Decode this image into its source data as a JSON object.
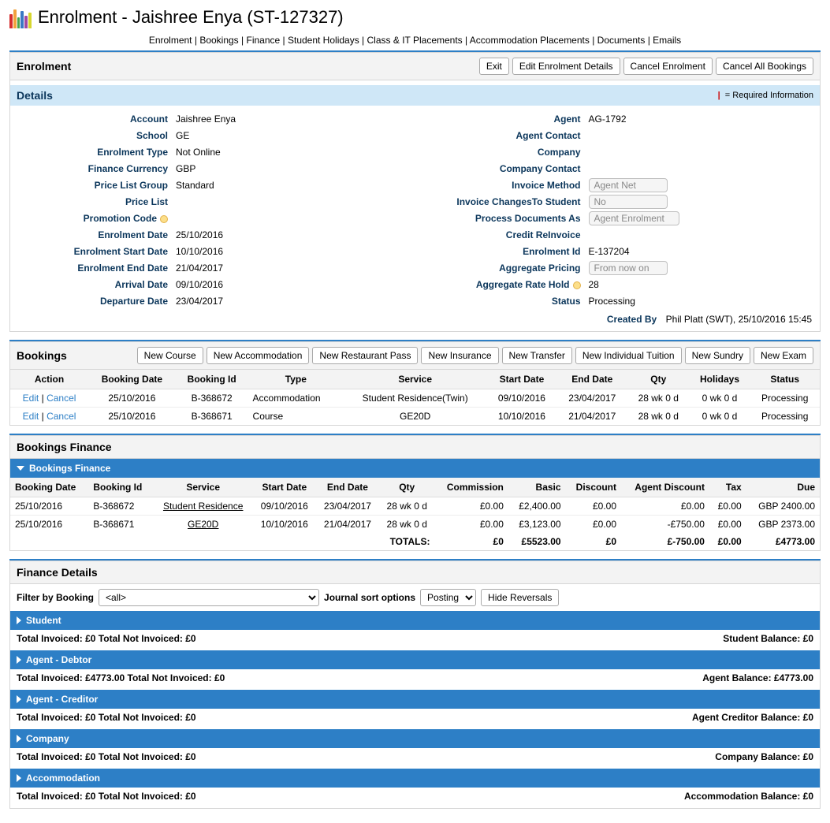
{
  "page_title": "Enrolment - Jaishree Enya (ST-127327)",
  "top_nav": [
    "Enrolment",
    "Bookings",
    "Finance",
    "Student Holidays",
    "Class & IT Placements",
    "Accommodation Placements",
    "Documents",
    "Emails"
  ],
  "enrolment_panel": {
    "title": "Enrolment",
    "buttons": [
      "Exit",
      "Edit Enrolment Details",
      "Cancel Enrolment",
      "Cancel All Bookings"
    ]
  },
  "details_bar": {
    "title": "Details",
    "required_note": "= Required Information"
  },
  "details": {
    "left": [
      {
        "label": "Account",
        "value": "Jaishree Enya"
      },
      {
        "label": "School",
        "value": "GE"
      },
      {
        "label": "Enrolment Type",
        "value": "Not Online"
      },
      {
        "label": "Finance Currency",
        "value": "GBP"
      },
      {
        "label": "Price List Group",
        "value": "Standard"
      },
      {
        "label": "Price List",
        "value": ""
      },
      {
        "label": "Promotion Code",
        "value": "",
        "dot": true
      },
      {
        "label": "Enrolment Date",
        "value": "25/10/2016"
      },
      {
        "label": "Enrolment Start Date",
        "value": "10/10/2016"
      },
      {
        "label": "Enrolment End Date",
        "value": "21/04/2017"
      },
      {
        "label": "Arrival Date",
        "value": "09/10/2016"
      },
      {
        "label": "Departure Date",
        "value": "23/04/2017"
      }
    ],
    "right": [
      {
        "label": "Agent",
        "value": "AG-1792"
      },
      {
        "label": "Agent Contact",
        "value": ""
      },
      {
        "label": "Company",
        "value": ""
      },
      {
        "label": "Company Contact",
        "value": ""
      },
      {
        "label": "Invoice Method",
        "select": "Agent Net"
      },
      {
        "label": "Invoice ChangesTo Student",
        "select": "No"
      },
      {
        "label": "Process Documents As",
        "select": "Agent Enrolment"
      },
      {
        "label": "Credit ReInvoice",
        "value": ""
      },
      {
        "label": "Enrolment Id",
        "value": "E-137204"
      },
      {
        "label": "Aggregate Pricing",
        "select": "From now on"
      },
      {
        "label": "Aggregate Rate Hold",
        "value": "28",
        "dot": true
      },
      {
        "label": "Status",
        "value": "Processing"
      }
    ],
    "created_by_label": "Created By",
    "created_by_value": "Phil Platt (SWT), 25/10/2016 15:45"
  },
  "bookings_panel": {
    "title": "Bookings",
    "buttons": [
      "New Course",
      "New Accommodation",
      "New Restaurant Pass",
      "New Insurance",
      "New Transfer",
      "New Individual Tuition",
      "New Sundry",
      "New Exam"
    ],
    "columns": [
      "Action",
      "Booking Date",
      "Booking Id",
      "Type",
      "Service",
      "Start Date",
      "End Date",
      "Qty",
      "Holidays",
      "Status"
    ],
    "rows": [
      {
        "action_edit": "Edit",
        "action_cancel": "Cancel",
        "date": "25/10/2016",
        "id": "B-368672",
        "type": "Accommodation",
        "service": "Student Residence(Twin)",
        "start": "09/10/2016",
        "end": "23/04/2017",
        "qty": "28 wk 0 d",
        "hol": "0 wk 0 d",
        "status": "Processing"
      },
      {
        "action_edit": "Edit",
        "action_cancel": "Cancel",
        "date": "25/10/2016",
        "id": "B-368671",
        "type": "Course",
        "service": "GE20D",
        "start": "10/10/2016",
        "end": "21/04/2017",
        "qty": "28 wk 0 d",
        "hol": "0 wk 0 d",
        "status": "Processing"
      }
    ]
  },
  "bookings_finance": {
    "panel_title": "Bookings Finance",
    "bar_title": "Bookings Finance",
    "columns": [
      "Booking Date",
      "Booking Id",
      "Service",
      "Start Date",
      "End Date",
      "Qty",
      "Commission",
      "Basic",
      "Discount",
      "Agent Discount",
      "Tax",
      "Due"
    ],
    "rows": [
      {
        "date": "25/10/2016",
        "id": "B-368672",
        "service": "Student Residence",
        "start": "09/10/2016",
        "end": "23/04/2017",
        "qty": "28 wk 0 d",
        "comm": "£0.00",
        "basic": "£2,400.00",
        "disc": "£0.00",
        "agent_disc": "£0.00",
        "tax": "£0.00",
        "due": "GBP 2400.00"
      },
      {
        "date": "25/10/2016",
        "id": "B-368671",
        "service": "GE20D",
        "start": "10/10/2016",
        "end": "21/04/2017",
        "qty": "28 wk 0 d",
        "comm": "£0.00",
        "basic": "£3,123.00",
        "disc": "£0.00",
        "agent_disc": "-£750.00",
        "tax": "£0.00",
        "due": "GBP 2373.00"
      }
    ],
    "totals": {
      "label": "TOTALS:",
      "comm": "£0",
      "basic": "£5523.00",
      "disc": "£0",
      "agent_disc": "£-750.00",
      "tax": "£0.00",
      "due": "£4773.00"
    }
  },
  "finance_details": {
    "title": "Finance Details",
    "filter_label": "Filter by Booking",
    "filter_value": "<all>",
    "journal_label": "Journal sort options",
    "journal_value": "Posting",
    "hide_button": "Hide Reversals",
    "sections": [
      {
        "name": "Student",
        "inv": "Total Invoiced: £0",
        "notinv": "Total Not Invoiced: £0",
        "bal": "Student Balance: £0"
      },
      {
        "name": "Agent - Debtor",
        "inv": "Total Invoiced: £4773.00",
        "notinv": "Total Not Invoiced: £0",
        "bal": "Agent Balance: £4773.00"
      },
      {
        "name": "Agent - Creditor",
        "inv": "Total Invoiced: £0",
        "notinv": "Total Not Invoiced: £0",
        "bal": "Agent Creditor Balance: £0"
      },
      {
        "name": "Company",
        "inv": "Total Invoiced: £0",
        "notinv": "Total Not Invoiced: £0",
        "bal": "Company Balance: £0"
      },
      {
        "name": "Accommodation",
        "inv": "Total Invoiced: £0",
        "notinv": "Total Not Invoiced: £0",
        "bal": "Accommodation Balance: £0"
      }
    ]
  }
}
